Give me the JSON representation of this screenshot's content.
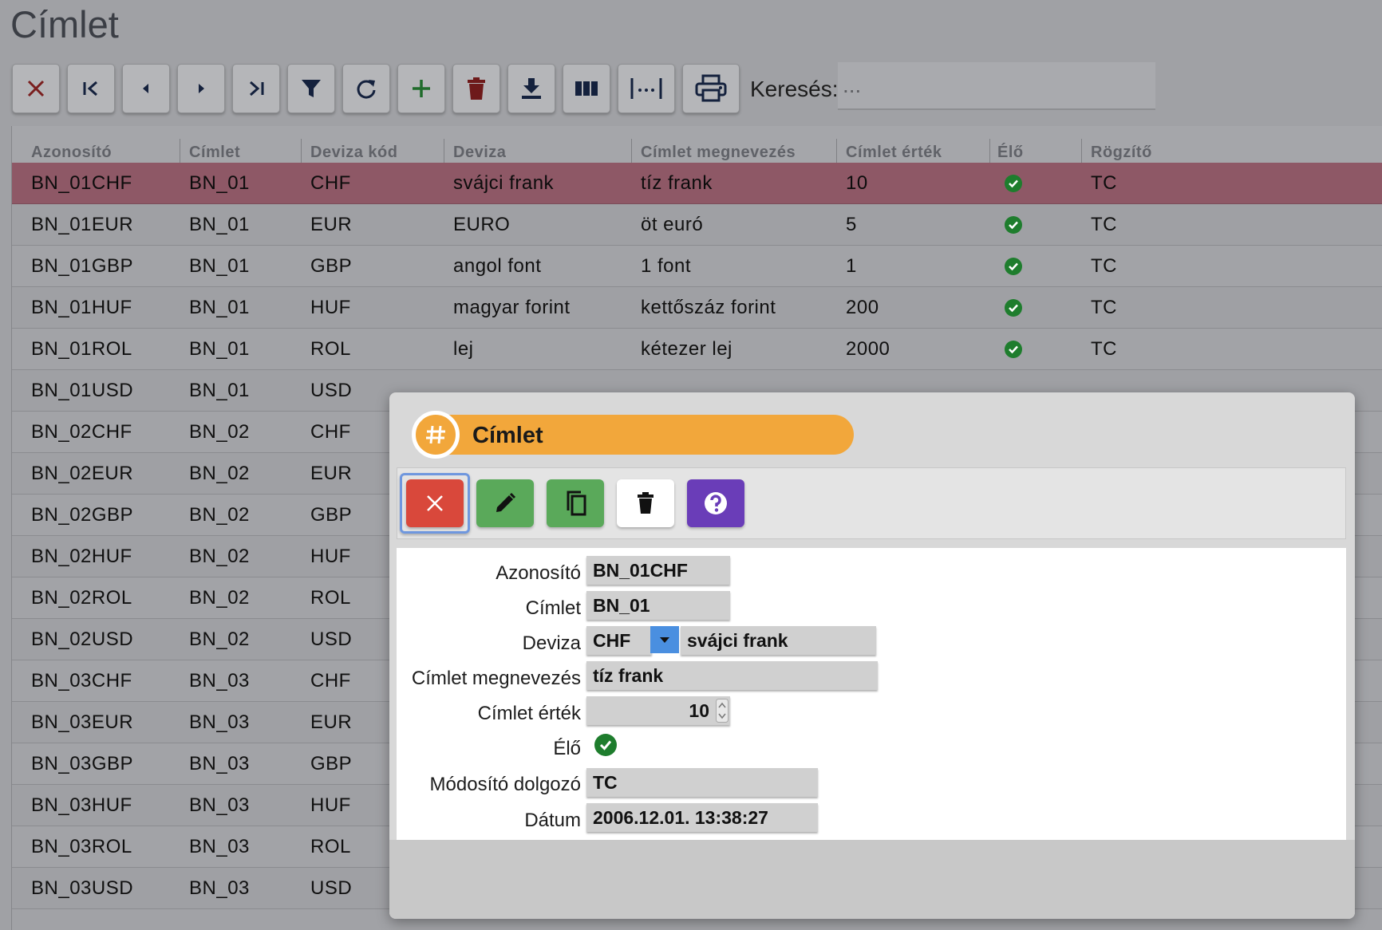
{
  "page": {
    "title": "Címlet"
  },
  "toolbar": {
    "buttons": [
      {
        "icon": "close-icon"
      },
      {
        "icon": "first-page-icon"
      },
      {
        "icon": "previous-icon"
      },
      {
        "icon": "next-icon"
      },
      {
        "icon": "last-page-icon"
      },
      {
        "icon": "filter-icon"
      },
      {
        "icon": "refresh-icon"
      },
      {
        "icon": "add-icon"
      },
      {
        "icon": "trash-icon"
      },
      {
        "icon": "download-icon"
      },
      {
        "icon": "columns-icon"
      },
      {
        "icon": "fit-width-icon"
      },
      {
        "icon": "print-icon"
      }
    ],
    "search_label": "Keresés:",
    "search_placeholder": "..."
  },
  "grid": {
    "columns": [
      "Azonosító",
      "Címlet",
      "Deviza kód",
      "Deviza",
      "Címlet megnevezés",
      "Címlet érték",
      "Élő",
      "Rögzítő"
    ],
    "rows": [
      [
        "BN_01CHF",
        "BN_01",
        "CHF",
        "svájci frank",
        "tíz frank",
        "10",
        true,
        "TC"
      ],
      [
        "BN_01EUR",
        "BN_01",
        "EUR",
        "EURO",
        "öt euró",
        "5",
        true,
        "TC"
      ],
      [
        "BN_01GBP",
        "BN_01",
        "GBP",
        "angol font",
        "1 font",
        "1",
        true,
        "TC"
      ],
      [
        "BN_01HUF",
        "BN_01",
        "HUF",
        "magyar forint",
        "kettőszáz forint",
        "200",
        true,
        "TC"
      ],
      [
        "BN_01ROL",
        "BN_01",
        "ROL",
        "lej",
        "kétezer lej",
        "2000",
        true,
        "TC"
      ],
      [
        "BN_01USD",
        "BN_01",
        "USD",
        "",
        "",
        "",
        false,
        ""
      ],
      [
        "BN_02CHF",
        "BN_02",
        "CHF",
        "",
        "",
        "",
        false,
        ""
      ],
      [
        "BN_02EUR",
        "BN_02",
        "EUR",
        "",
        "",
        "",
        false,
        ""
      ],
      [
        "BN_02GBP",
        "BN_02",
        "GBP",
        "",
        "",
        "",
        false,
        ""
      ],
      [
        "BN_02HUF",
        "BN_02",
        "HUF",
        "",
        "",
        "",
        false,
        ""
      ],
      [
        "BN_02ROL",
        "BN_02",
        "ROL",
        "",
        "",
        "",
        false,
        ""
      ],
      [
        "BN_02USD",
        "BN_02",
        "USD",
        "",
        "",
        "",
        false,
        ""
      ],
      [
        "BN_03CHF",
        "BN_03",
        "CHF",
        "",
        "",
        "",
        false,
        ""
      ],
      [
        "BN_03EUR",
        "BN_03",
        "EUR",
        "",
        "",
        "",
        false,
        ""
      ],
      [
        "BN_03GBP",
        "BN_03",
        "GBP",
        "",
        "",
        "",
        false,
        ""
      ],
      [
        "BN_03HUF",
        "BN_03",
        "HUF",
        "",
        "",
        "",
        false,
        ""
      ],
      [
        "BN_03ROL",
        "BN_03",
        "ROL",
        "",
        "",
        "",
        false,
        ""
      ],
      [
        "BN_03USD",
        "BN_03",
        "USD",
        "",
        "",
        "",
        false,
        ""
      ]
    ],
    "selected_row": 0
  },
  "modal": {
    "title": "Címlet",
    "title_icon": "hash-icon",
    "actions": [
      {
        "name": "close",
        "icon": "close-icon",
        "color": "#d9483b"
      },
      {
        "name": "edit",
        "icon": "pencil-icon",
        "color": "#5aa95a"
      },
      {
        "name": "copy",
        "icon": "copy-icon",
        "color": "#5aa95a"
      },
      {
        "name": "delete",
        "icon": "trash-icon",
        "color": "#ffffff"
      },
      {
        "name": "help",
        "icon": "help-icon",
        "color": "#6a3db8"
      }
    ],
    "form": {
      "azonosito": {
        "label": "Azonosító",
        "value": "BN_01CHF"
      },
      "cimlet": {
        "label": "Címlet",
        "value": "BN_01"
      },
      "deviza": {
        "label": "Deviza",
        "code": "CHF",
        "name": "svájci frank"
      },
      "megnevezes": {
        "label": "Címlet megnevezés",
        "value": "tíz frank"
      },
      "ertek": {
        "label": "Címlet érték",
        "value": "10"
      },
      "elo": {
        "label": "Élő",
        "value": true
      },
      "modosito": {
        "label": "Módosító dolgozó",
        "value": "TC"
      },
      "datum": {
        "label": "Dátum",
        "value": "2006.12.01. 13:38:27"
      }
    }
  },
  "colors": {
    "selected_row": "#8e5866",
    "accent_orange": "#f2a73b",
    "check_green": "#1e7d2d"
  }
}
